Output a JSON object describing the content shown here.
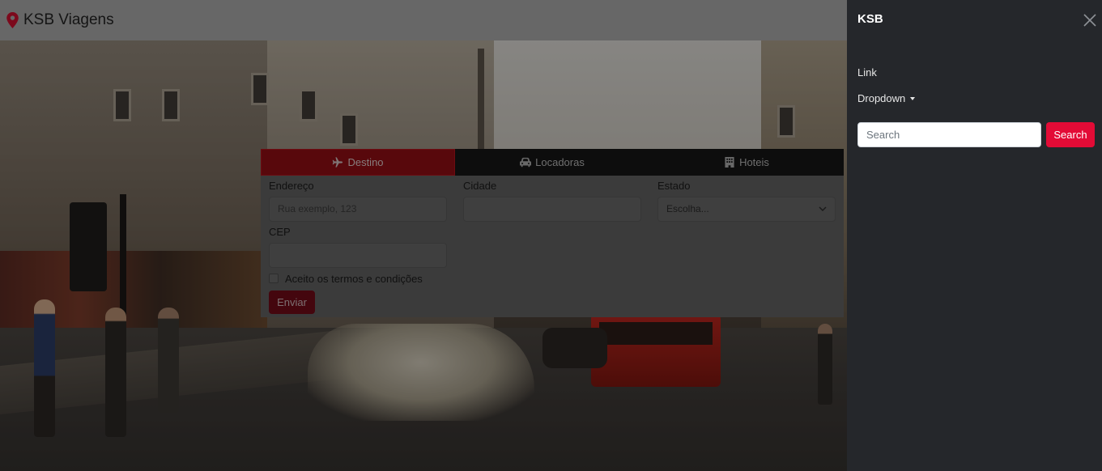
{
  "navbar": {
    "brand": "KSB Viagens",
    "brand_icon": "map-pin-icon",
    "brand_color": "#c8102e"
  },
  "booking": {
    "tabs": [
      {
        "label": "Destino",
        "icon": "plane-icon",
        "active": true
      },
      {
        "label": "Locadoras",
        "icon": "car-icon",
        "active": false
      },
      {
        "label": "Hoteis",
        "icon": "hotel-icon",
        "active": false
      }
    ],
    "fields": {
      "address": {
        "label": "Endereço",
        "placeholder": "Rua exemplo, 123",
        "value": ""
      },
      "city": {
        "label": "Cidade",
        "value": ""
      },
      "state": {
        "label": "Estado",
        "selected": "Escolha..."
      },
      "zip": {
        "label": "CEP",
        "value": ""
      }
    },
    "terms_label": "Aceito os termos e condições",
    "submit_label": "Enviar",
    "accent": "#8f0d14"
  },
  "offcanvas": {
    "title": "KSB",
    "link_label": "Link",
    "dropdown_label": "Dropdown",
    "search_placeholder": "Search",
    "search_button": "Search",
    "button_color": "#e30b36",
    "background": "#25272b"
  }
}
